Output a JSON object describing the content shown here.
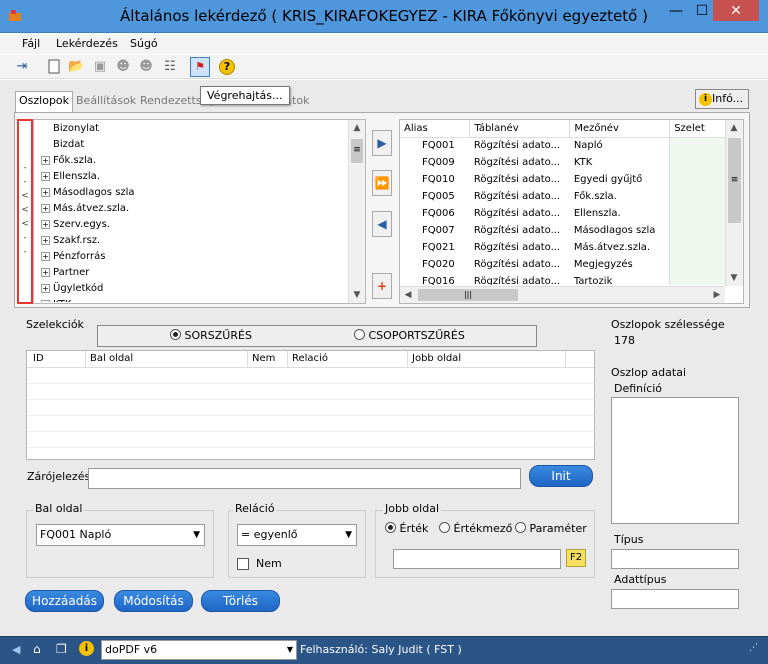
{
  "window": {
    "title": "Általános lekérdező ( KRIS_KIRAFOKEGYEZ - KIRA Főkönyvi egyeztető )",
    "min": "—",
    "max": "☐",
    "close": "✕"
  },
  "menu": [
    "Fájl",
    "Lekérdezés",
    "Súgó"
  ],
  "tabs": [
    "Oszlopok",
    "Beállítások",
    "Rendezettség",
    "Adatok"
  ],
  "tooltip": "Végrehajtás...",
  "info_button": "Infó...",
  "tree_items": [
    {
      "label": "Bizonylat",
      "exp": false
    },
    {
      "label": "Bizdat",
      "exp": false
    },
    {
      "label": "Fők.szla.",
      "exp": true
    },
    {
      "label": "Ellenszla.",
      "exp": true
    },
    {
      "label": "Másodlagos szla",
      "exp": true
    },
    {
      "label": "Más.átvez.szla.",
      "exp": true
    },
    {
      "label": "Szerv.egys.",
      "exp": true
    },
    {
      "label": "Szakf.rsz.",
      "exp": true
    },
    {
      "label": "Pénzforrás",
      "exp": true
    },
    {
      "label": "Partner",
      "exp": true
    },
    {
      "label": "Ügyletkód",
      "exp": true
    },
    {
      "label": "KTK",
      "exp": true
    }
  ],
  "columns_table": {
    "headers": [
      "Alias",
      "Táblanév",
      "Mezőnév",
      "Szelet"
    ],
    "rows": [
      [
        "FQ001",
        "Rögzítési adato...",
        "Napló"
      ],
      [
        "FQ009",
        "Rögzítési adato...",
        "KTK"
      ],
      [
        "FQ010",
        "Rögzítési adato...",
        "Egyedi gyűjtő"
      ],
      [
        "FQ005",
        "Rögzítési adato...",
        "Fők.szla."
      ],
      [
        "FQ006",
        "Rögzítési adato...",
        "Ellenszla."
      ],
      [
        "FQ007",
        "Rögzítési adato...",
        "Másodlagos szla"
      ],
      [
        "FQ021",
        "Rögzítési adato...",
        "Más.átvez.szla."
      ],
      [
        "FQ020",
        "Rögzítési adato...",
        "Megjegyzés"
      ],
      [
        "FQ016",
        "Rögzítési adato...",
        "Tartozik"
      ]
    ]
  },
  "selections": {
    "title": "Szelekciók",
    "radio1": "SORSZŰRÉS",
    "radio2": "CSOPORTSZŰRÉS",
    "headers": [
      "ID",
      "Bal oldal",
      "Nem",
      "Relació",
      "Jobb oldal"
    ]
  },
  "zarojelezes_label": "Zárójelezés",
  "init_button": "Init",
  "bal_oldal": {
    "label": "Bal oldal",
    "value": "FQ001 Napló"
  },
  "relacio": {
    "label": "Reláció",
    "value": "= egyenlő",
    "nem": "Nem"
  },
  "jobb_oldal": {
    "label": "Jobb oldal",
    "opt1": "Érték",
    "opt2": "Értékmező",
    "opt3": "Paraméter",
    "f2": "F2"
  },
  "buttons": {
    "add": "Hozzáadás",
    "modify": "Módosítás",
    "delete": "Törlés"
  },
  "right_panel": {
    "col_width_label": "Oszlopok szélessége",
    "col_width_value": "178",
    "col_data_label": "Oszlop adatai",
    "definition_label": "Definíció",
    "type_label": "Típus",
    "datatype_label": "Adattípus"
  },
  "status": {
    "printer": "doPDF v6",
    "user": "Felhasználó: Saly Judit ( FST )"
  }
}
